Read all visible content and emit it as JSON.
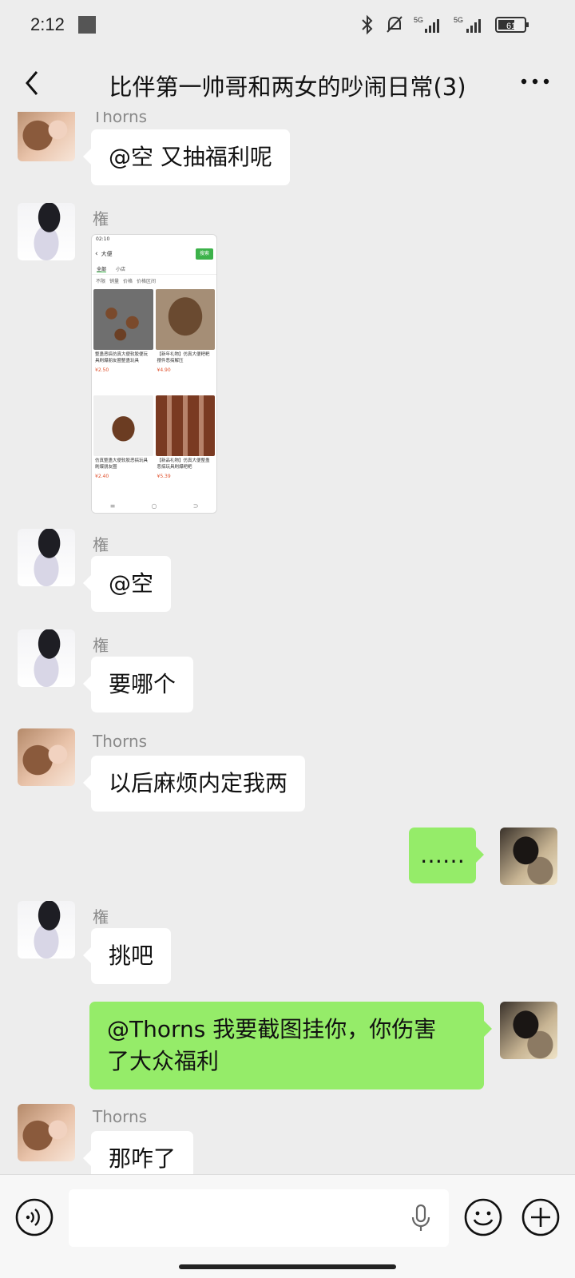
{
  "status_bar": {
    "time": "2:12",
    "battery": "61"
  },
  "header": {
    "title": "比伴第一帅哥和两女的吵闹日常(3)"
  },
  "messages": [
    {
      "sender": "Thorns",
      "text": "@空  又抽福利呢"
    },
    {
      "sender": "権",
      "image": {
        "status_time": "02:10",
        "search_query": "大便",
        "search_button": "搜索",
        "tabs": [
          "全部",
          "小店"
        ],
        "filters": [
          "不限",
          "销量",
          "价格",
          "价格区间"
        ],
        "cards": [
          {
            "title": "整蛊恶搞仿真大便软胶便玩具刷爆朋友圈整蛊玩具",
            "price": "¥2.50"
          },
          {
            "title": "【新年礼物】仿真大便粑粑摆件恶搞解压",
            "price": "¥4.90"
          },
          {
            "title": "仿真整蛊大便软胶恶搞玩具刷爆朋友圈",
            "price": "¥2.40"
          },
          {
            "title": "【新品礼物】仿真大便整蛊恶搞玩具刷爆粑粑",
            "price": "¥5.39"
          }
        ]
      }
    },
    {
      "sender": "権",
      "text": "@空"
    },
    {
      "sender": "権",
      "text": "要哪个"
    },
    {
      "sender": "Thorns",
      "text": "以后麻烦内定我两"
    },
    {
      "sender": "me",
      "text": "……"
    },
    {
      "sender": "権",
      "text": "挑吧"
    },
    {
      "sender": "me",
      "text_line1": "@Thorns  我要截图挂你，你伤害",
      "text_line2": "了大众福利"
    },
    {
      "sender": "Thorns",
      "text": "那咋了"
    }
  ],
  "colors": {
    "background": "#ededed",
    "outgoing_bubble": "#95ec69",
    "incoming_bubble": "#ffffff"
  }
}
